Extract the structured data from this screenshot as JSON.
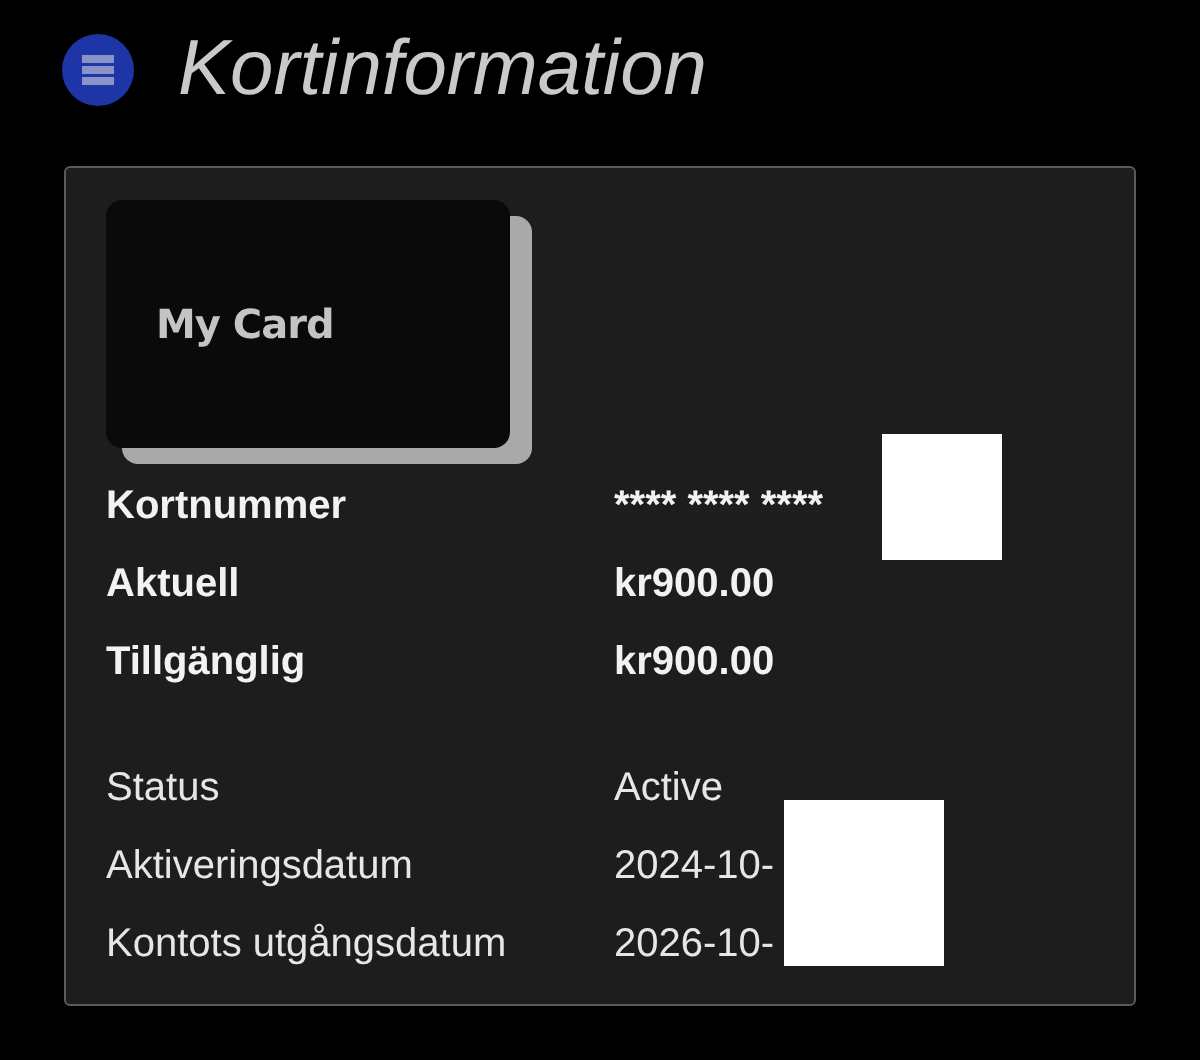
{
  "header": {
    "title": "Kortinformation"
  },
  "card": {
    "label": "My Card"
  },
  "groups": [
    {
      "kind": "summary",
      "rows": [
        {
          "label": "Kortnummer",
          "value": "**** **** ****",
          "redacted": true
        },
        {
          "label": "Aktuell",
          "value": "kr900.00",
          "redacted": false
        },
        {
          "label": "Tillgänglig",
          "value": "kr900.00",
          "redacted": false
        }
      ]
    },
    {
      "kind": "details",
      "rows": [
        {
          "label": "Status",
          "value": "Active",
          "redacted": false
        },
        {
          "label": "Aktiveringsdatum",
          "value": "2024-10-",
          "redacted": true
        },
        {
          "label": "Kontots utgångsdatum",
          "value": "2026-10-",
          "redacted": true
        }
      ]
    }
  ]
}
